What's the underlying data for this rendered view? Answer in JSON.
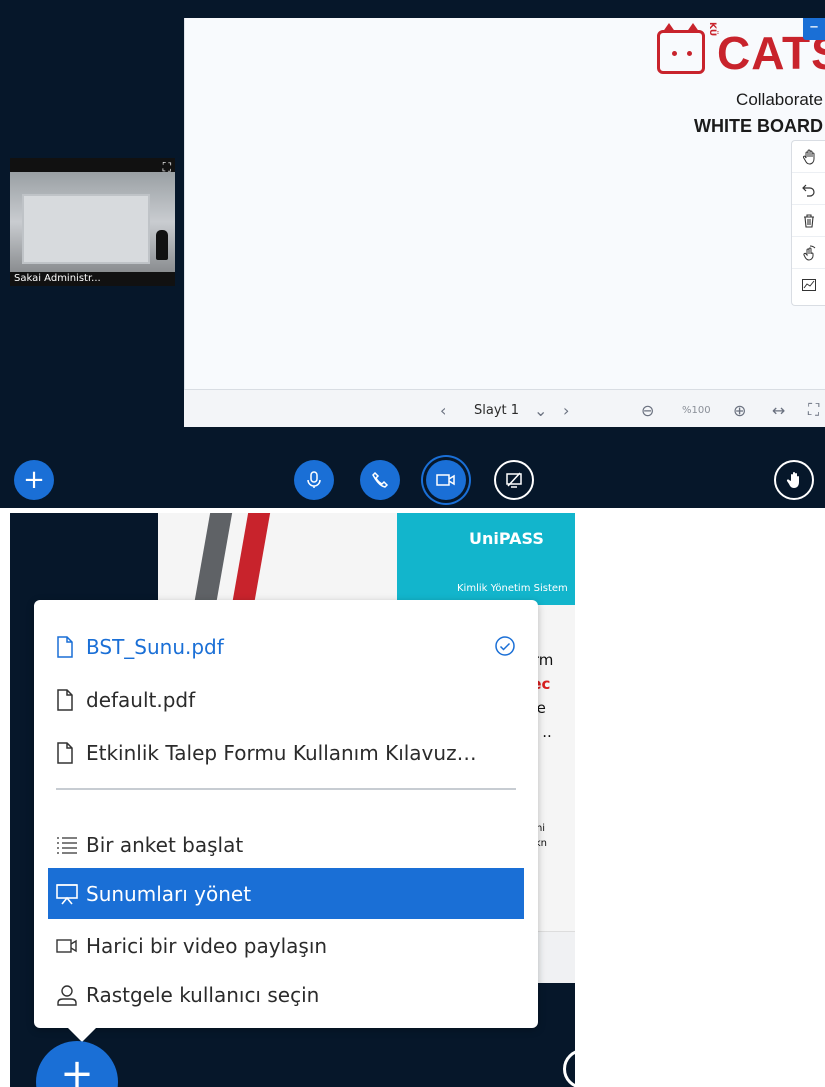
{
  "whiteboard": {
    "logo_ku": "KÜ",
    "logo_text": "CATS",
    "logo_sub": "Collaborate",
    "logo_title": "WHITE BOARD",
    "corner_label": "–",
    "slide_prev": "‹",
    "slide_label": "Slayt 1",
    "slide_dropdown": "⌄",
    "slide_next": "›",
    "zoom_out": "⊖",
    "zoom_level": "%100",
    "zoom_in": "⊕",
    "fit_width": "↔",
    "fullscreen": "⛶"
  },
  "tools": [
    "hand-tool",
    "undo",
    "clear-all",
    "multi-user-pointer",
    "whiteboard-tool"
  ],
  "webcam": {
    "expand": "⛶",
    "name": "Sakai Administr..."
  },
  "actionbar": {
    "plus": "+",
    "mic": "🎙",
    "phone": "✆",
    "camera": "▭",
    "screenshare": "⧄",
    "raise_hand": "✋"
  },
  "slide": {
    "unipass_title": "UniPASS",
    "unipass_sub": "Kimlik Yönetim Sistem",
    "lines": [
      "ştirm",
      "u.ec",
      "izde",
      "MS ..",
      "ür Üni",
      "e Tekn"
    ]
  },
  "menu": {
    "items": [
      {
        "label": "BST_Sunu.pdf",
        "icon": "file-icon"
      },
      {
        "label": "default.pdf",
        "icon": "file-icon"
      },
      {
        "label": "Etkinlik Talep Formu Kullanım Kılavuz…",
        "icon": "file-icon"
      },
      {
        "label": "Bir anket başlat",
        "icon": "poll-icon"
      },
      {
        "label": "Sunumları yönet",
        "icon": "presentation-icon"
      },
      {
        "label": "Harici bir video paylaşın",
        "icon": "video-icon"
      },
      {
        "label": "Rastgele kullanıcı seçin",
        "icon": "user-icon"
      }
    ]
  },
  "fab_plus": "+",
  "colors": {
    "accent": "#1a6fd6",
    "dark_bg": "#06172a",
    "brand_red": "#c8232c"
  }
}
